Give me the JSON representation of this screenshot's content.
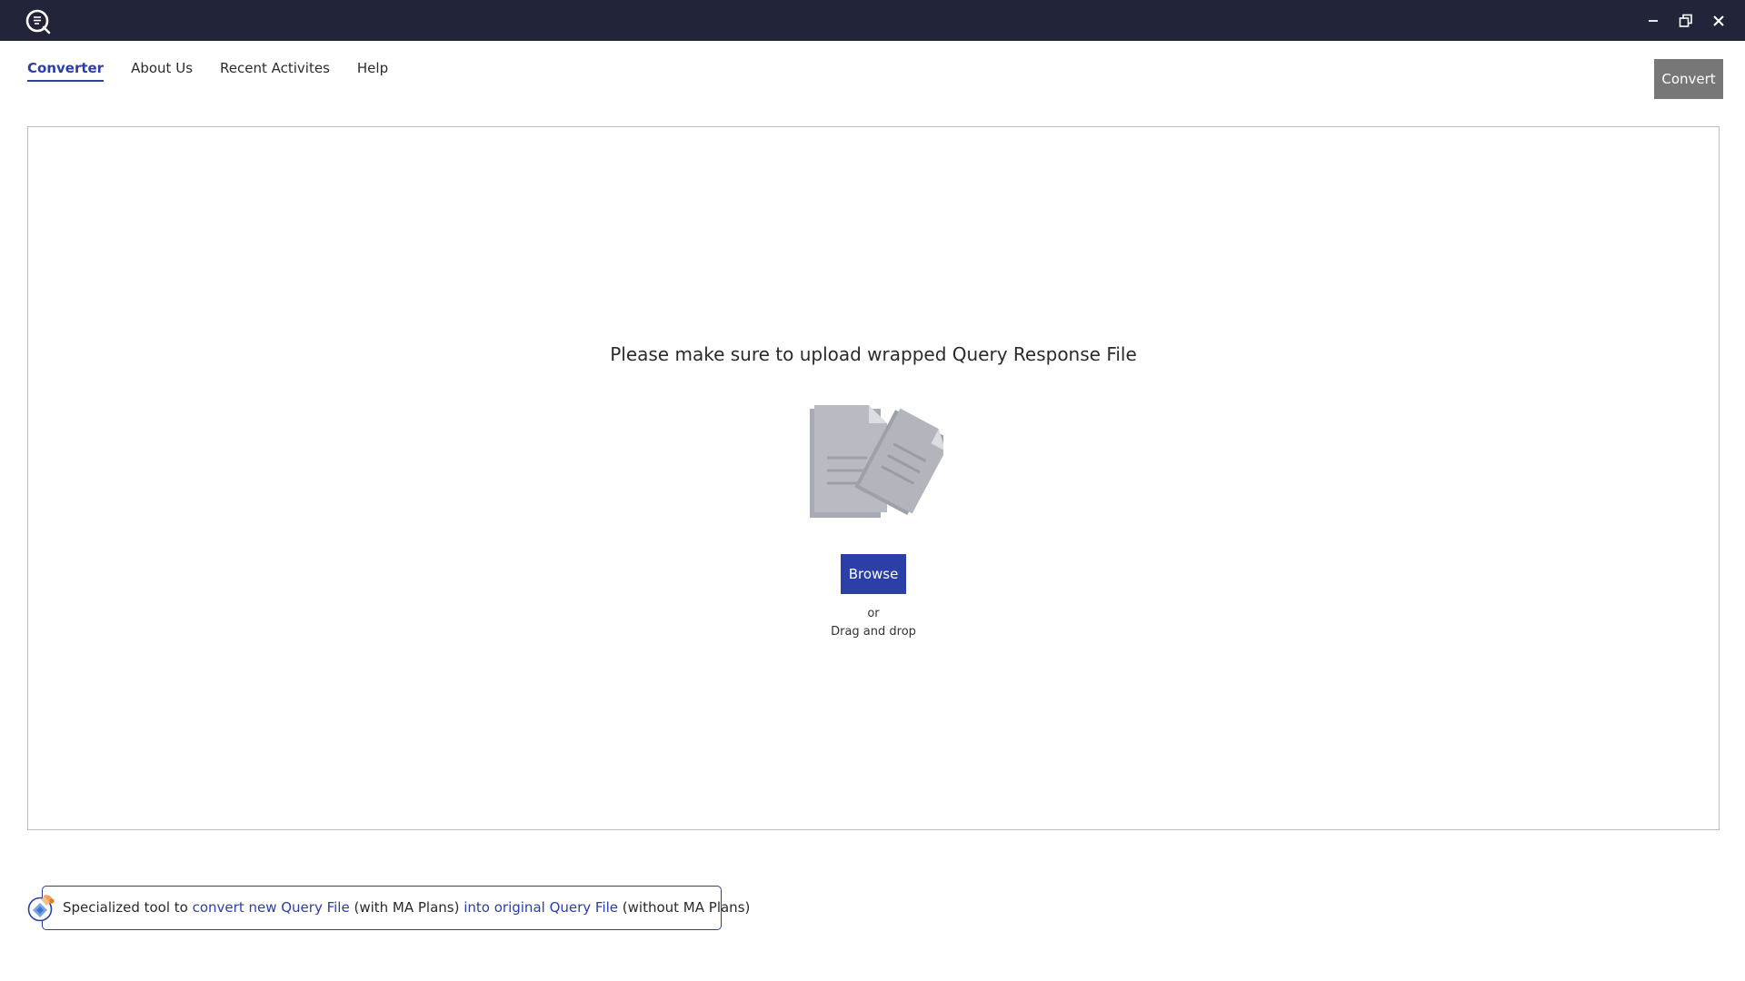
{
  "titlebar": {
    "logo_icon": "query-logo-icon",
    "controls": {
      "minimize_icon": "minimize-icon",
      "restore_icon": "restore-icon",
      "close_icon": "close-icon"
    },
    "background": "#22253a"
  },
  "nav": {
    "items": [
      {
        "label": "Converter",
        "active": true
      },
      {
        "label": "About Us",
        "active": false
      },
      {
        "label": "Recent Activites",
        "active": false
      },
      {
        "label": "Help",
        "active": false
      }
    ]
  },
  "toolbar": {
    "convert_label": "Convert"
  },
  "dropzone": {
    "message": "Please make sure to upload wrapped Query Response File",
    "icon": "documents-icon",
    "browse_label": "Browse",
    "or_label": "or",
    "drag_label": "Drag and drop"
  },
  "banner": {
    "icon": "tool-badge-icon",
    "part1": "Specialized tool to ",
    "link1": "convert new Query File",
    "part2": " (with MA Plans) ",
    "link2": "into original Query File",
    "part3": " (without MA Plans)"
  },
  "colors": {
    "accent": "#2b3fa6",
    "disabled_button": "#777777"
  }
}
